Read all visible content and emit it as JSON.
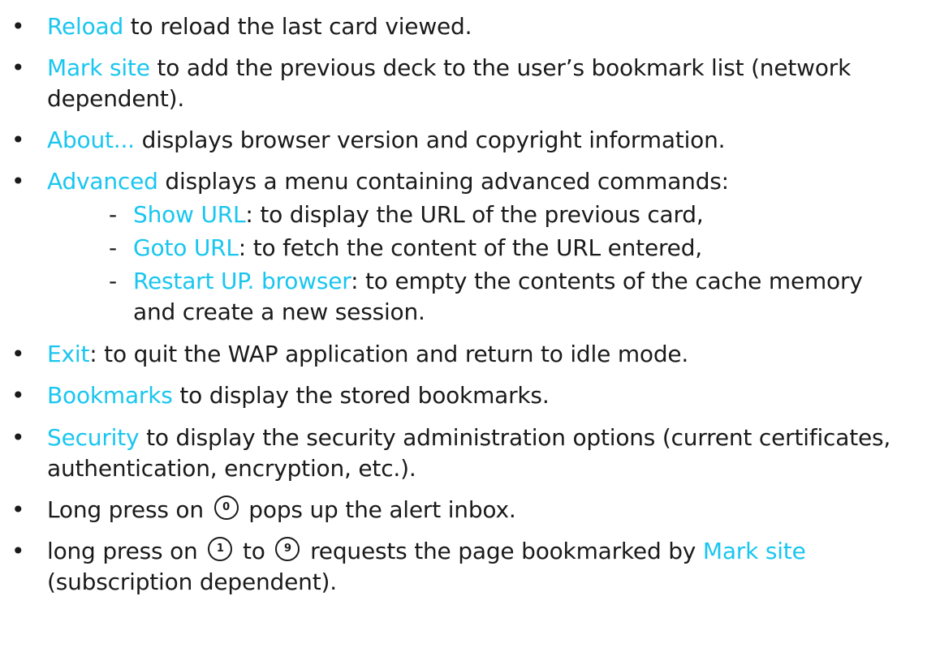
{
  "colors": {
    "text": "#1a1a1a",
    "keyword": "#19c6f0"
  },
  "bullet_glyph": "•",
  "dash_glyph": "-",
  "items": {
    "reload": {
      "kw": "Reload",
      "rest": " to reload the last card viewed."
    },
    "mark_site": {
      "kw": "Mark site",
      "rest": " to add the previous deck to the user’s bookmark list (network",
      "cont": "dependent)."
    },
    "about": {
      "kw": "About...",
      "rest": " displays browser version and copyright information."
    },
    "advanced": {
      "kw": "Advanced",
      "rest": " displays a menu containing advanced commands:"
    },
    "show_url": {
      "kw": "Show URL",
      "rest": ": to display the URL of the previous card,"
    },
    "goto_url": {
      "kw": "Goto URL",
      "rest": ": to fetch the content of the URL entered,"
    },
    "restart": {
      "kw": "Restart UP. browser",
      "rest": ": to empty the contents of the cache memory",
      "cont": "and create a new session."
    },
    "exit": {
      "kw": "Exit",
      "rest": ": to quit the WAP application and return to idle mode."
    },
    "bookmarks": {
      "kw": "Bookmarks",
      "rest": " to display the stored bookmarks."
    },
    "security": {
      "kw": "Security",
      "rest": " to display the security administration options (current certificates,",
      "cont": "authentication, encryption, etc.)."
    },
    "long_press_0": {
      "pre": "Long press on ",
      "key": "0",
      "rest": " pops up the alert inbox."
    },
    "long_press_1_9": {
      "pre": "long press on ",
      "key1": "1",
      "mid": " to ",
      "key2": "9",
      "rest": " requests the page bookmarked by ",
      "kw": "Mark site",
      "cont": "(subscription dependent)."
    }
  }
}
